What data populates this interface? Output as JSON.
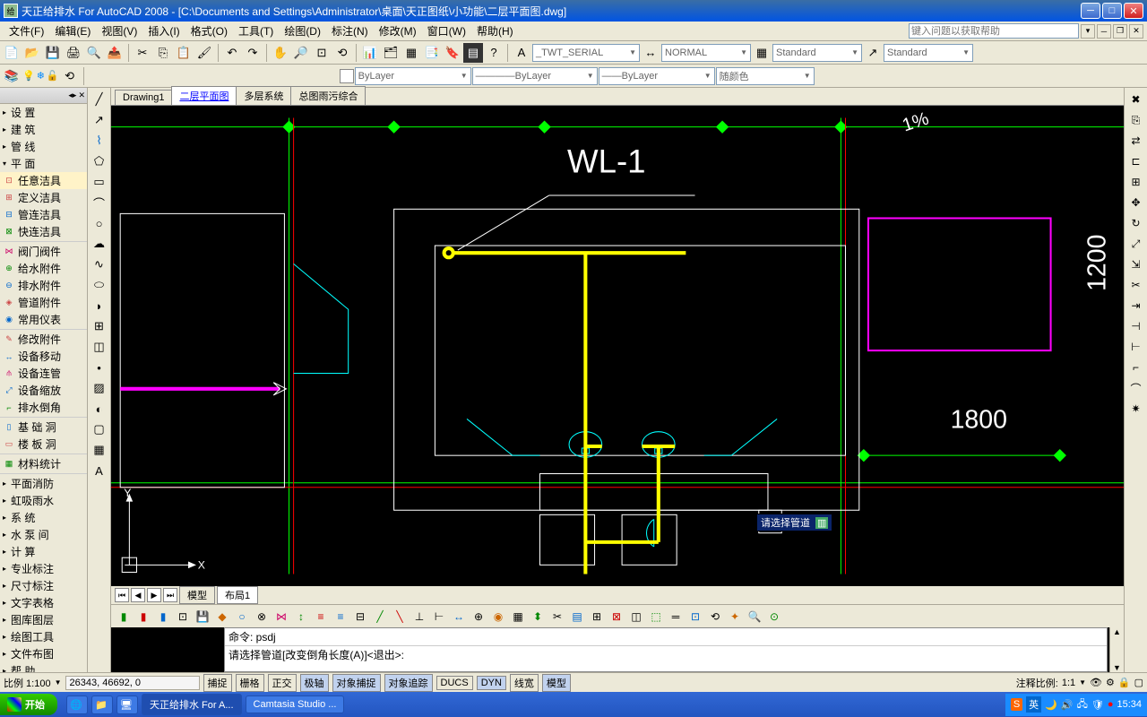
{
  "titlebar": {
    "title": "天正给排水 For AutoCAD 2008 - [C:\\Documents and Settings\\Administrator\\桌面\\天正图纸\\小功能\\二层平面图.dwg]"
  },
  "menus": [
    "文件(F)",
    "编辑(E)",
    "视图(V)",
    "插入(I)",
    "格式(O)",
    "工具(T)",
    "绘图(D)",
    "标注(N)",
    "修改(M)",
    "窗口(W)",
    "帮助(H)"
  ],
  "helpbox_placeholder": "键入问题以获取帮助",
  "layer_dd": "ByLayer",
  "style_dds": {
    "text": "_TWT_SERIAL",
    "dim": "NORMAL",
    "s1": "Standard",
    "s2": "Standard"
  },
  "color_dd": "随颜色",
  "left_items_top": [
    "设    置",
    "建    筑",
    "管    线",
    "平    面"
  ],
  "left_items_mid": [
    "任意洁具",
    "定义洁具",
    "管连洁具",
    "快连洁具"
  ],
  "left_items_mid2": [
    "阀门阀件",
    "给水附件",
    "排水附件",
    "管道附件",
    "常用仪表"
  ],
  "left_items_mid3": [
    "修改附件",
    "设备移动",
    "设备连管",
    "设备缩放",
    "排水倒角"
  ],
  "left_items_mid4": [
    "基 础 洞",
    "楼 板 洞"
  ],
  "left_items_mid5": [
    "材料统计"
  ],
  "left_items_bot": [
    "平面消防",
    "虹吸雨水",
    "系    统",
    "水 泵 间",
    "计    算",
    "专业标注",
    "尺寸标注",
    "文字表格",
    "图库图层",
    "绘图工具",
    "文件布图",
    "帮    助"
  ],
  "tabs_top": [
    "Drawing1",
    "二层平面图",
    "多层系统",
    "总图雨污综合"
  ],
  "active_tab_top": 1,
  "tabs_bot": [
    "模型",
    "布局1"
  ],
  "active_tab_bot": 0,
  "canvas": {
    "label_wl": "WL-1",
    "dim_1200": "1200",
    "dim_1800": "1800",
    "tooltip": "请选择管道",
    "slope": "1%",
    "ucs_x": "X",
    "ucs_y": "Y"
  },
  "cmd": {
    "line1": "命令: psdj",
    "line2": "请选择管道[改变倒角长度(A)]<退出>:"
  },
  "status": {
    "scale_label": "比例 1:100",
    "coords": "26343, 46692, 0",
    "toggles": [
      "捕捉",
      "栅格",
      "正交",
      "极轴",
      "对象捕捉",
      "对象追踪",
      "DUCS",
      "DYN",
      "线宽",
      "模型"
    ],
    "anno_label": "注释比例:",
    "anno_val": "1:1"
  },
  "taskbar": {
    "start": "开始",
    "tasks": [
      "天正给排水 For A...",
      "Camtasia Studio ..."
    ],
    "tray_lang": "英",
    "time": "15:34"
  }
}
